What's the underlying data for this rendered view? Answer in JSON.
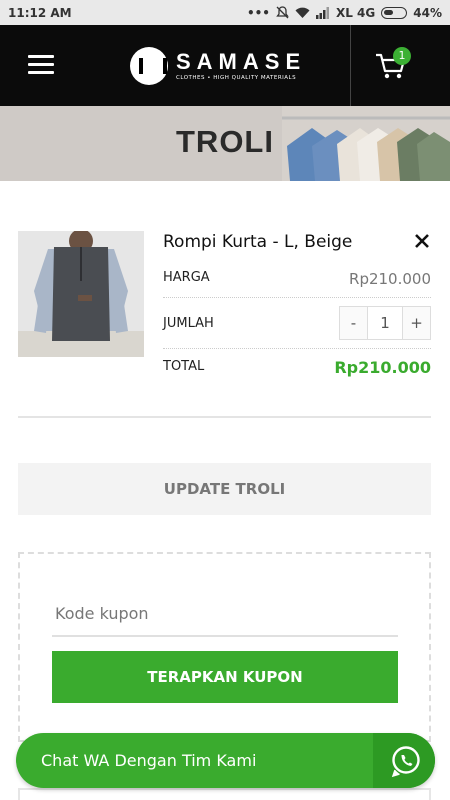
{
  "status_bar": {
    "time": "11:12 AM",
    "carrier": "XL 4G",
    "battery": "44%"
  },
  "header": {
    "brand": "SAMASE",
    "tagline": "CLOTHES • HIGH QUALITY MATERIALS",
    "cart_count": "1"
  },
  "banner": {
    "title": "TROLI"
  },
  "cart_item": {
    "name": "Rompi Kurta - L, Beige",
    "price_label": "HARGA",
    "price": "Rp210.000",
    "qty_label": "JUMLAH",
    "qty_minus": "-",
    "qty_value": "1",
    "qty_plus": "+",
    "total_label": "TOTAL",
    "total": "Rp210.000"
  },
  "actions": {
    "update_label": "UPDATE TROLI"
  },
  "coupon": {
    "placeholder": "Kode kupon",
    "apply_label": "TERAPKAN KUPON"
  },
  "whatsapp": {
    "label": "Chat WA Dengan Tim Kami"
  },
  "colors": {
    "accent_green": "#3aab2e",
    "header_bg": "#0b0b0b"
  }
}
